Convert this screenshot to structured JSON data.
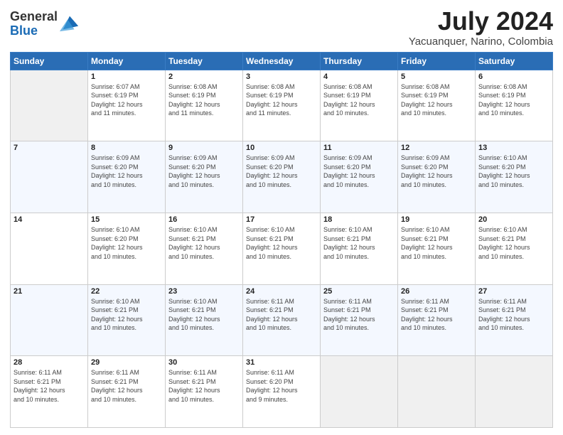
{
  "header": {
    "logo_general": "General",
    "logo_blue": "Blue",
    "month_year": "July 2024",
    "location": "Yacuanquer, Narino, Colombia"
  },
  "weekdays": [
    "Sunday",
    "Monday",
    "Tuesday",
    "Wednesday",
    "Thursday",
    "Friday",
    "Saturday"
  ],
  "weeks": [
    [
      {
        "day": "",
        "sunrise": "",
        "sunset": "",
        "daylight": ""
      },
      {
        "day": "1",
        "sunrise": "Sunrise: 6:07 AM",
        "sunset": "Sunset: 6:19 PM",
        "daylight": "Daylight: 12 hours and 11 minutes."
      },
      {
        "day": "2",
        "sunrise": "Sunrise: 6:08 AM",
        "sunset": "Sunset: 6:19 PM",
        "daylight": "Daylight: 12 hours and 11 minutes."
      },
      {
        "day": "3",
        "sunrise": "Sunrise: 6:08 AM",
        "sunset": "Sunset: 6:19 PM",
        "daylight": "Daylight: 12 hours and 11 minutes."
      },
      {
        "day": "4",
        "sunrise": "Sunrise: 6:08 AM",
        "sunset": "Sunset: 6:19 PM",
        "daylight": "Daylight: 12 hours and 10 minutes."
      },
      {
        "day": "5",
        "sunrise": "Sunrise: 6:08 AM",
        "sunset": "Sunset: 6:19 PM",
        "daylight": "Daylight: 12 hours and 10 minutes."
      },
      {
        "day": "6",
        "sunrise": "Sunrise: 6:08 AM",
        "sunset": "Sunset: 6:19 PM",
        "daylight": "Daylight: 12 hours and 10 minutes."
      }
    ],
    [
      {
        "day": "7",
        "sunrise": "",
        "sunset": "",
        "daylight": ""
      },
      {
        "day": "8",
        "sunrise": "Sunrise: 6:09 AM",
        "sunset": "Sunset: 6:20 PM",
        "daylight": "Daylight: 12 hours and 10 minutes."
      },
      {
        "day": "9",
        "sunrise": "Sunrise: 6:09 AM",
        "sunset": "Sunset: 6:20 PM",
        "daylight": "Daylight: 12 hours and 10 minutes."
      },
      {
        "day": "10",
        "sunrise": "Sunrise: 6:09 AM",
        "sunset": "Sunset: 6:20 PM",
        "daylight": "Daylight: 12 hours and 10 minutes."
      },
      {
        "day": "11",
        "sunrise": "Sunrise: 6:09 AM",
        "sunset": "Sunset: 6:20 PM",
        "daylight": "Daylight: 12 hours and 10 minutes."
      },
      {
        "day": "12",
        "sunrise": "Sunrise: 6:09 AM",
        "sunset": "Sunset: 6:20 PM",
        "daylight": "Daylight: 12 hours and 10 minutes."
      },
      {
        "day": "13",
        "sunrise": "Sunrise: 6:10 AM",
        "sunset": "Sunset: 6:20 PM",
        "daylight": "Daylight: 12 hours and 10 minutes."
      }
    ],
    [
      {
        "day": "14",
        "sunrise": "",
        "sunset": "",
        "daylight": ""
      },
      {
        "day": "15",
        "sunrise": "Sunrise: 6:10 AM",
        "sunset": "Sunset: 6:20 PM",
        "daylight": "Daylight: 12 hours and 10 minutes."
      },
      {
        "day": "16",
        "sunrise": "Sunrise: 6:10 AM",
        "sunset": "Sunset: 6:21 PM",
        "daylight": "Daylight: 12 hours and 10 minutes."
      },
      {
        "day": "17",
        "sunrise": "Sunrise: 6:10 AM",
        "sunset": "Sunset: 6:21 PM",
        "daylight": "Daylight: 12 hours and 10 minutes."
      },
      {
        "day": "18",
        "sunrise": "Sunrise: 6:10 AM",
        "sunset": "Sunset: 6:21 PM",
        "daylight": "Daylight: 12 hours and 10 minutes."
      },
      {
        "day": "19",
        "sunrise": "Sunrise: 6:10 AM",
        "sunset": "Sunset: 6:21 PM",
        "daylight": "Daylight: 12 hours and 10 minutes."
      },
      {
        "day": "20",
        "sunrise": "Sunrise: 6:10 AM",
        "sunset": "Sunset: 6:21 PM",
        "daylight": "Daylight: 12 hours and 10 minutes."
      }
    ],
    [
      {
        "day": "21",
        "sunrise": "",
        "sunset": "",
        "daylight": ""
      },
      {
        "day": "22",
        "sunrise": "Sunrise: 6:10 AM",
        "sunset": "Sunset: 6:21 PM",
        "daylight": "Daylight: 12 hours and 10 minutes."
      },
      {
        "day": "23",
        "sunrise": "Sunrise: 6:10 AM",
        "sunset": "Sunset: 6:21 PM",
        "daylight": "Daylight: 12 hours and 10 minutes."
      },
      {
        "day": "24",
        "sunrise": "Sunrise: 6:11 AM",
        "sunset": "Sunset: 6:21 PM",
        "daylight": "Daylight: 12 hours and 10 minutes."
      },
      {
        "day": "25",
        "sunrise": "Sunrise: 6:11 AM",
        "sunset": "Sunset: 6:21 PM",
        "daylight": "Daylight: 12 hours and 10 minutes."
      },
      {
        "day": "26",
        "sunrise": "Sunrise: 6:11 AM",
        "sunset": "Sunset: 6:21 PM",
        "daylight": "Daylight: 12 hours and 10 minutes."
      },
      {
        "day": "27",
        "sunrise": "Sunrise: 6:11 AM",
        "sunset": "Sunset: 6:21 PM",
        "daylight": "Daylight: 12 hours and 10 minutes."
      }
    ],
    [
      {
        "day": "28",
        "sunrise": "Sunrise: 6:11 AM",
        "sunset": "Sunset: 6:21 PM",
        "daylight": "Daylight: 12 hours and 10 minutes."
      },
      {
        "day": "29",
        "sunrise": "Sunrise: 6:11 AM",
        "sunset": "Sunset: 6:21 PM",
        "daylight": "Daylight: 12 hours and 10 minutes."
      },
      {
        "day": "30",
        "sunrise": "Sunrise: 6:11 AM",
        "sunset": "Sunset: 6:21 PM",
        "daylight": "Daylight: 12 hours and 10 minutes."
      },
      {
        "day": "31",
        "sunrise": "Sunrise: 6:11 AM",
        "sunset": "Sunset: 6:20 PM",
        "daylight": "Daylight: 12 hours and 9 minutes."
      },
      {
        "day": "",
        "sunrise": "",
        "sunset": "",
        "daylight": ""
      },
      {
        "day": "",
        "sunrise": "",
        "sunset": "",
        "daylight": ""
      },
      {
        "day": "",
        "sunrise": "",
        "sunset": "",
        "daylight": ""
      }
    ]
  ],
  "week1_row0": {
    "sunday": {
      "sunrise": "",
      "sunset": "",
      "daylight": ""
    },
    "monday": {
      "day": "1",
      "sunrise": "Sunrise: 6:07 AM",
      "sunset": "Sunset: 6:19 PM",
      "daylight": "Daylight: 12 hours and 11 minutes."
    }
  }
}
